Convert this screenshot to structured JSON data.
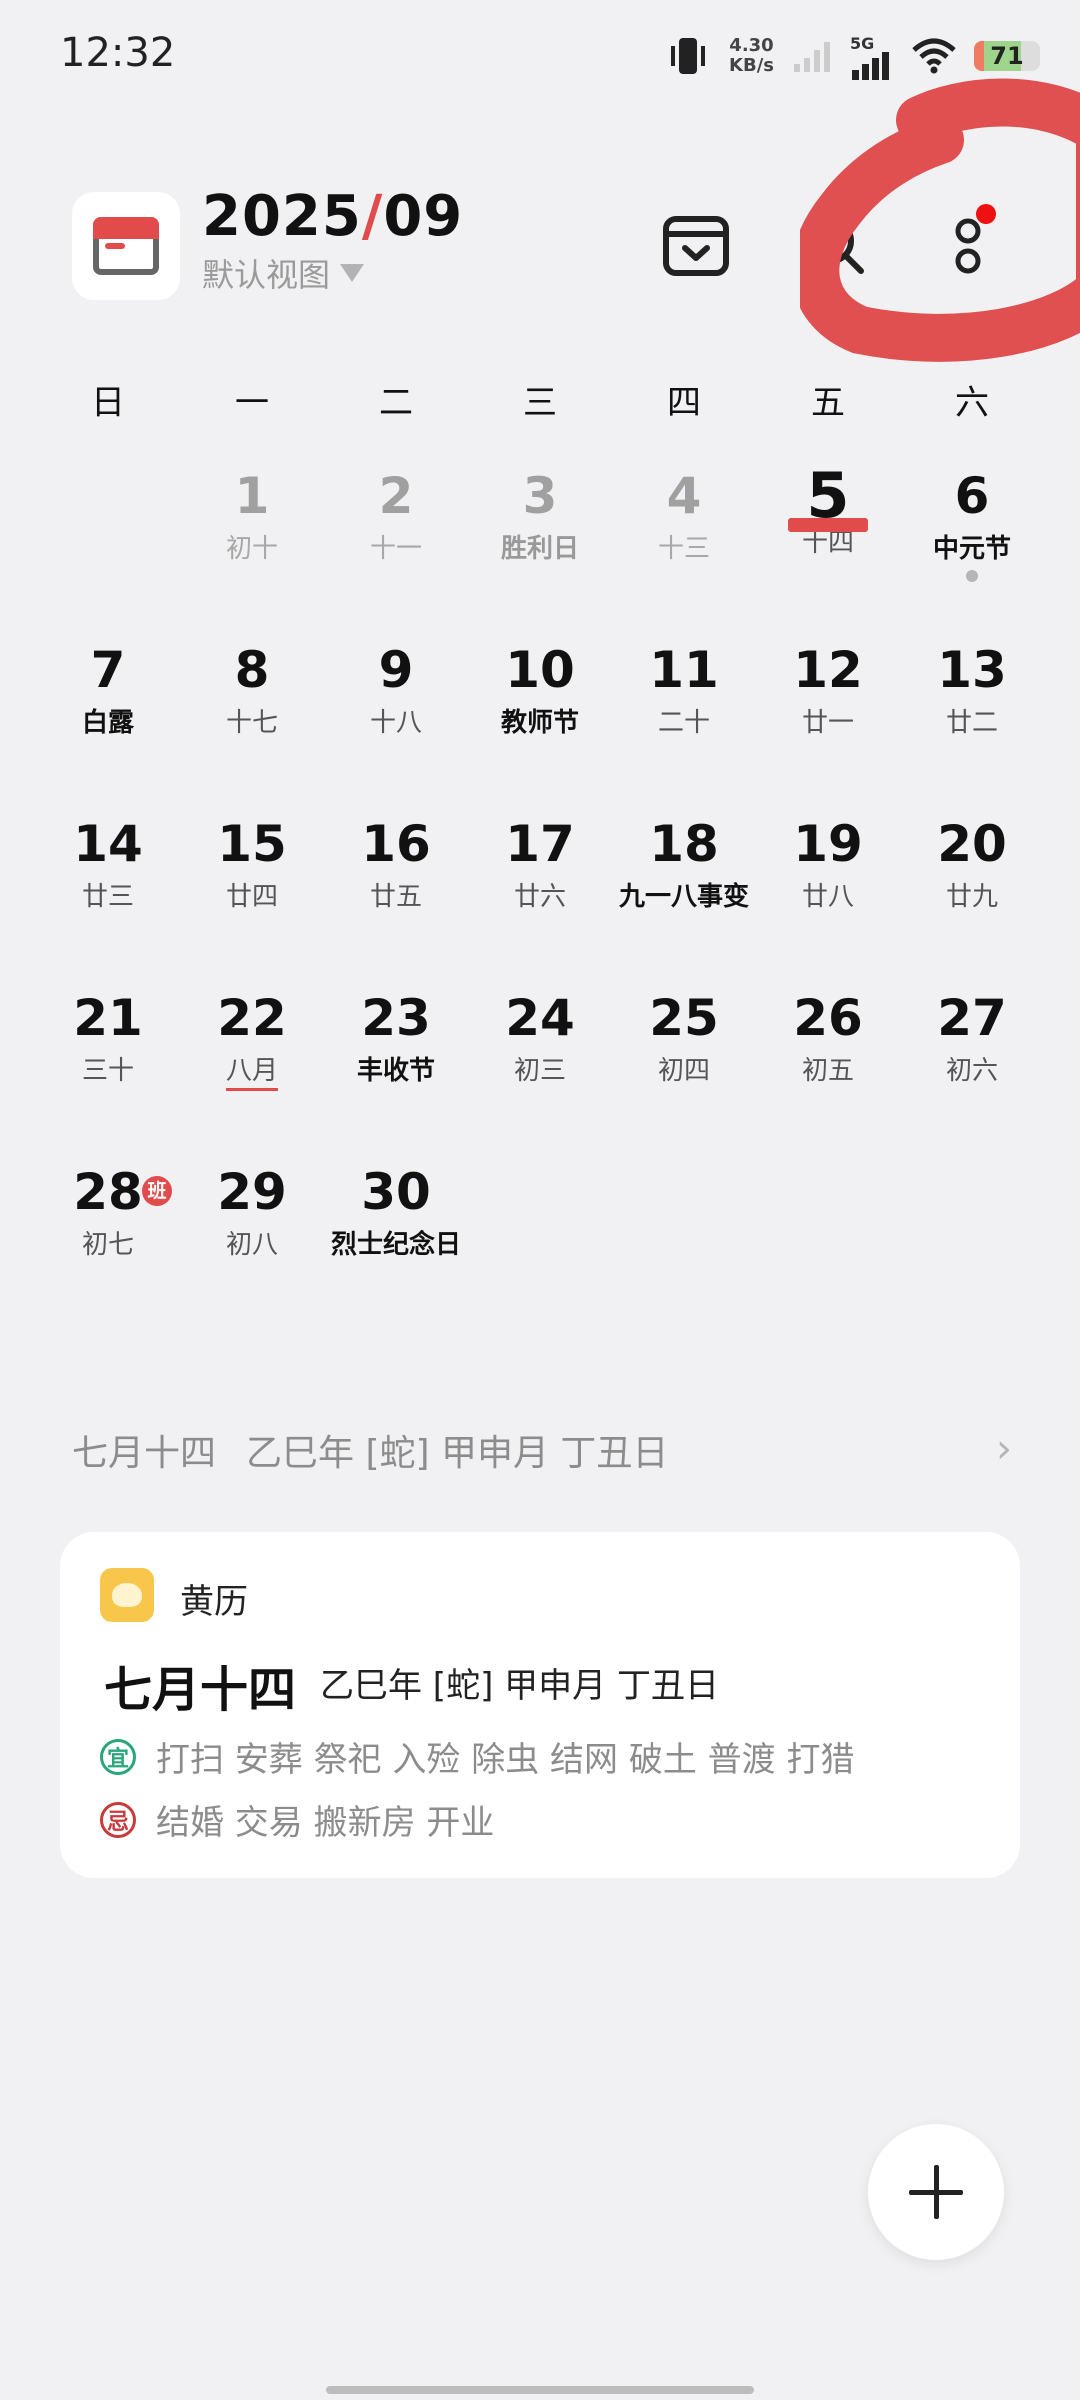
{
  "status_bar": {
    "time": "12:32",
    "net_speed_value": "4.30",
    "net_speed_unit": "KB/s",
    "network": "5G",
    "battery": "71",
    "battery_level": 0.71
  },
  "header": {
    "year": "2025",
    "slash": "/",
    "month": "09",
    "view_label": "默认视图",
    "icons": [
      "inbox-icon",
      "search-icon",
      "more-icon"
    ]
  },
  "weekdays": [
    "日",
    "一",
    "二",
    "三",
    "四",
    "五",
    "六"
  ],
  "calendar": {
    "weeks": [
      [
        null,
        {
          "day": "1",
          "lunar": "初十"
        },
        {
          "day": "2",
          "lunar": "十一"
        },
        {
          "day": "3",
          "lunar": "胜利日"
        },
        {
          "day": "4",
          "lunar": "十三"
        },
        {
          "day": "5",
          "lunar": "十四"
        },
        {
          "day": "6",
          "lunar": "中元节"
        }
      ],
      [
        {
          "day": "7",
          "lunar": "白露"
        },
        {
          "day": "8",
          "lunar": "十七"
        },
        {
          "day": "9",
          "lunar": "十八"
        },
        {
          "day": "10",
          "lunar": "教师节"
        },
        {
          "day": "11",
          "lunar": "二十"
        },
        {
          "day": "12",
          "lunar": "廿一"
        },
        {
          "day": "13",
          "lunar": "廿二"
        }
      ],
      [
        {
          "day": "14",
          "lunar": "廿三"
        },
        {
          "day": "15",
          "lunar": "廿四"
        },
        {
          "day": "16",
          "lunar": "廿五"
        },
        {
          "day": "17",
          "lunar": "廿六"
        },
        {
          "day": "18",
          "lunar": "九一八事变"
        },
        {
          "day": "19",
          "lunar": "廿八"
        },
        {
          "day": "20",
          "lunar": "廿九"
        }
      ],
      [
        {
          "day": "21",
          "lunar": "三十"
        },
        {
          "day": "22",
          "lunar": "八月"
        },
        {
          "day": "23",
          "lunar": "丰收节"
        },
        {
          "day": "24",
          "lunar": "初三"
        },
        {
          "day": "25",
          "lunar": "初四"
        },
        {
          "day": "26",
          "lunar": "初五"
        },
        {
          "day": "27",
          "lunar": "初六"
        }
      ],
      [
        {
          "day": "28",
          "lunar": "初七",
          "badge": "班"
        },
        {
          "day": "29",
          "lunar": "初八"
        },
        {
          "day": "30",
          "lunar": "烈士纪念日"
        }
      ]
    ]
  },
  "lunar_info": {
    "lunar_date": "七月十四",
    "ganzhi": "乙巳年 [蛇] 甲申月 丁丑日"
  },
  "almanac_card": {
    "title": "黄历",
    "lunar_date": "七月十四",
    "ganzhi": "乙巳年 [蛇] 甲申月 丁丑日",
    "yi_label": "宜",
    "yi_text": "打扫 安葬 祭祀 入殓 除虫 结网 破土 普渡 打猎",
    "ji_label": "忌",
    "ji_text": "结婚 交易 搬新房 开业"
  },
  "colors": {
    "accent": "#e14b4b",
    "background": "#f1f1f3",
    "yi": "#2aa77a",
    "ji": "#c93a3a",
    "annotation": "#e05050"
  }
}
